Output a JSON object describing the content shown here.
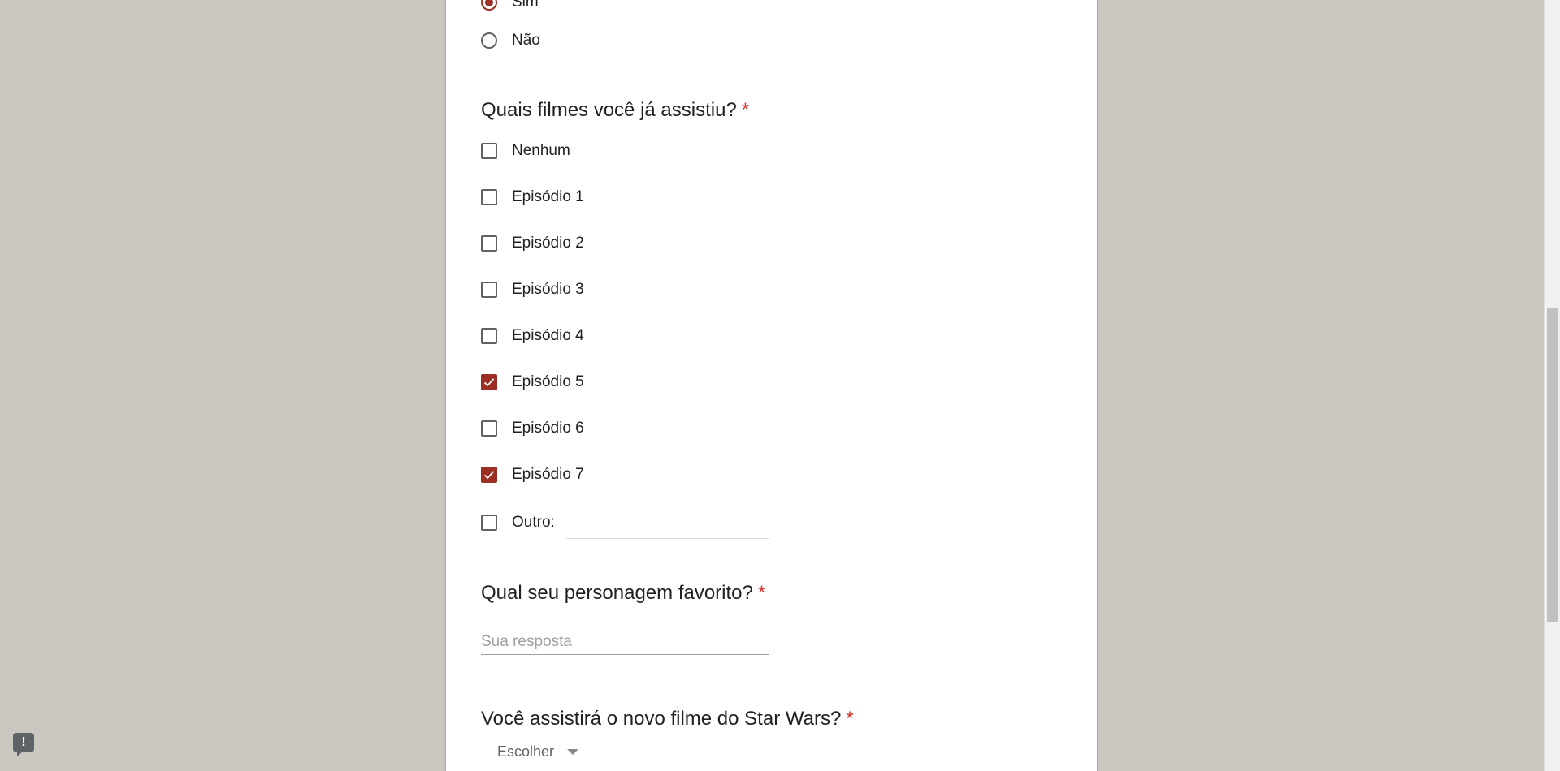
{
  "q1": {
    "options": [
      {
        "label": "Sim",
        "checked": true
      },
      {
        "label": "Não",
        "checked": false
      }
    ]
  },
  "q2": {
    "title": "Quais filmes você já assistiu?",
    "required_mark": "*",
    "options": [
      {
        "label": "Nenhum",
        "checked": false
      },
      {
        "label": "Episódio 1",
        "checked": false
      },
      {
        "label": "Episódio 2",
        "checked": false
      },
      {
        "label": "Episódio 3",
        "checked": false
      },
      {
        "label": "Episódio 4",
        "checked": false
      },
      {
        "label": "Episódio 5",
        "checked": true
      },
      {
        "label": "Episódio 6",
        "checked": false
      },
      {
        "label": "Episódio 7",
        "checked": true
      },
      {
        "label": "Outro:",
        "checked": false
      }
    ],
    "other_value": ""
  },
  "q3": {
    "title": "Qual seu personagem favorito?",
    "required_mark": "*",
    "placeholder": "Sua resposta",
    "value": ""
  },
  "q4": {
    "title": "Você assistirá o novo filme do Star Wars?",
    "required_mark": "*",
    "select_value": "Escolher"
  },
  "colors": {
    "accent": "#9c2f23",
    "required": "#d93025",
    "background": "#cbc8c2"
  },
  "feedback": {
    "glyph": "!"
  }
}
